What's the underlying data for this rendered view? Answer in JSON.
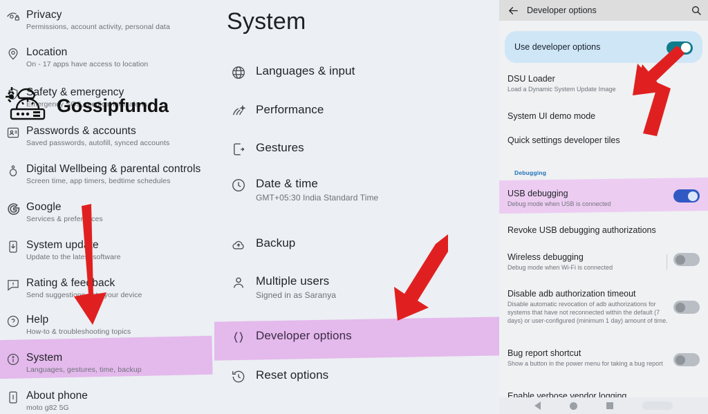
{
  "left_panel": {
    "items": [
      {
        "icon": "privacy-eye-lock-icon",
        "title": "Privacy",
        "sub": "Permissions, account activity, personal data"
      },
      {
        "icon": "location-pin-icon",
        "title": "Location",
        "sub": "On - 17 apps have access to location"
      },
      {
        "icon": "safety-emergency-icon",
        "title": "Safety & emergency",
        "sub": "Emergency SOS, medical info, alerts"
      },
      {
        "icon": "passwords-accounts-icon",
        "title": "Passwords & accounts",
        "sub": "Saved passwords, autofill, synced accounts"
      },
      {
        "icon": "digital-wellbeing-icon",
        "title": "Digital Wellbeing & parental controls",
        "sub": "Screen time, app timers, bedtime schedules"
      },
      {
        "icon": "google-g-icon",
        "title": "Google",
        "sub": "Services & preferences"
      },
      {
        "icon": "system-update-icon",
        "title": "System update",
        "sub": "Update to the latest software"
      },
      {
        "icon": "rating-feedback-icon",
        "title": "Rating & feedback",
        "sub": "Send suggestions, rate your device"
      },
      {
        "icon": "help-question-icon",
        "title": "Help",
        "sub": "How-to & troubleshooting topics"
      },
      {
        "icon": "system-info-icon",
        "title": "System",
        "sub": "Languages, gestures, time, backup"
      },
      {
        "icon": "about-phone-icon",
        "title": "About phone",
        "sub": "moto g82 5G"
      }
    ]
  },
  "mid_panel": {
    "heading": "System",
    "items": [
      {
        "icon": "globe-icon",
        "title": "Languages & input",
        "sub": ""
      },
      {
        "icon": "performance-icon",
        "title": "Performance",
        "sub": ""
      },
      {
        "icon": "gestures-icon",
        "title": "Gestures",
        "sub": ""
      },
      {
        "icon": "clock-icon",
        "title": "Date & time",
        "sub": "GMT+05:30 India Standard Time"
      },
      {
        "icon": "backup-cloud-icon",
        "title": "Backup",
        "sub": ""
      },
      {
        "icon": "person-icon",
        "title": "Multiple users",
        "sub": "Signed in as Saranya"
      },
      {
        "icon": "braces-icon",
        "title": "Developer options",
        "sub": ""
      },
      {
        "icon": "reset-history-icon",
        "title": "Reset options",
        "sub": ""
      }
    ]
  },
  "right_panel": {
    "header": {
      "back_icon": "back-arrow-icon",
      "title": "Developer options",
      "search_icon": "search-icon"
    },
    "master_toggle": {
      "label": "Use developer options",
      "state": "on",
      "color": "#0f7c8c"
    },
    "items": [
      {
        "title": "DSU Loader",
        "sub": "Load a Dynamic System Update Image",
        "toggle": "none"
      },
      {
        "title": "System UI demo mode",
        "sub": "",
        "toggle": "none"
      },
      {
        "title": "Quick settings developer tiles",
        "sub": "",
        "toggle": "none"
      }
    ],
    "section_label": "Debugging",
    "debug_items": [
      {
        "title": "USB debugging",
        "sub": "Debug mode when USB is connected",
        "toggle": "on",
        "highlighted": true
      },
      {
        "title": "Revoke USB debugging authorizations",
        "sub": "",
        "toggle": "none",
        "highlighted": false
      },
      {
        "title": "Wireless debugging",
        "sub": "Debug mode when Wi-Fi is connected",
        "toggle": "off",
        "highlighted": false
      },
      {
        "title": "Disable adb authorization timeout",
        "sub": "Disable automatic revocation of adb authorizations for systems that have not reconnected within the default (7 days) or user-configured (minimum 1 day) amount of time.",
        "toggle": "off",
        "highlighted": false
      },
      {
        "title": "Bug report shortcut",
        "sub": "Show a button in the power menu for taking a bug report",
        "toggle": "off",
        "highlighted": false
      },
      {
        "title": "Enable verbose vendor logging",
        "sub": "",
        "toggle": "none",
        "highlighted": false
      }
    ],
    "navbar": {
      "back": "nav-back-icon",
      "home": "nav-home-icon",
      "recents": "nav-recents-icon"
    }
  },
  "watermark": {
    "text": "Gossipfunda",
    "icon": "gossipfunda-logo-icon"
  },
  "annotations": {
    "arrow_left": "red-arrow-down",
    "arrow_mid": "red-arrow-down-right",
    "arrow_right": "red-arrow-up",
    "arrow_color": "#e02020",
    "highlight_color": "#e3b4ec"
  }
}
